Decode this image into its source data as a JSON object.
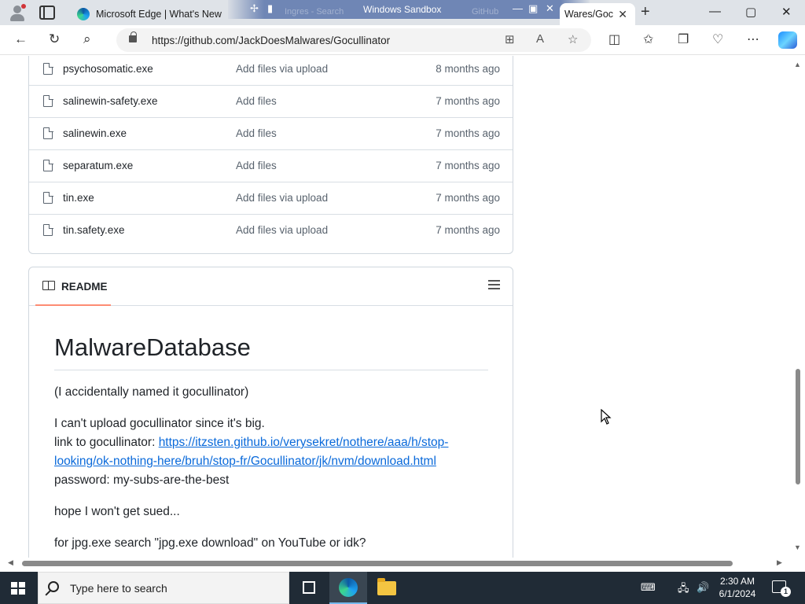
{
  "browser": {
    "tabs": [
      {
        "label": "Microsoft Edge | What's New"
      },
      {
        "label": "Wares/Goc"
      }
    ],
    "sandbox_title": "Windows Sandbox",
    "ghost_tabs": [
      "Ingres - Search",
      "GitHub"
    ],
    "url": "https://github.com/JackDoesMalwares/Gocullinator",
    "close_glyph": "✕",
    "new_tab_glyph": "+",
    "win_min": "—",
    "win_max": "▢",
    "win_close": "✕"
  },
  "files": [
    {
      "name": "psychosomatic.exe",
      "message": "Add files via upload",
      "date": "8 months ago"
    },
    {
      "name": "salinewin-safety.exe",
      "message": "Add files",
      "date": "7 months ago"
    },
    {
      "name": "salinewin.exe",
      "message": "Add files",
      "date": "7 months ago"
    },
    {
      "name": "separatum.exe",
      "message": "Add files",
      "date": "7 months ago"
    },
    {
      "name": "tin.exe",
      "message": "Add files via upload",
      "date": "7 months ago"
    },
    {
      "name": "tin.safety.exe",
      "message": "Add files via upload",
      "date": "7 months ago"
    }
  ],
  "readme": {
    "tab_label": "README",
    "heading": "MalwareDatabase",
    "p1": "(I accidentally named it gocullinator)",
    "p2_line1": "I can't upload gocullinator since it's big.",
    "p2_link_prefix": "link to gocullinator: ",
    "p2_link": "https://itzsten.github.io/verysekret/nothere/aaa/h/stop-looking/ok-nothing-here/bruh/stop-fr/Gocullinator/jk/nvm/download.html",
    "p2_password": "password: my-subs-are-the-best",
    "p3": "hope I won't get sued...",
    "p4": "for jpg.exe search \"jpg.exe download\" on YouTube or idk?"
  },
  "taskbar": {
    "search_placeholder": "Type here to search",
    "time": "2:30 AM",
    "date": "6/1/2024",
    "notification_count": "1"
  },
  "colors": {
    "link": "#0969da",
    "readme_tab_underline": "#fd8c73",
    "taskbar": "#202b36"
  }
}
